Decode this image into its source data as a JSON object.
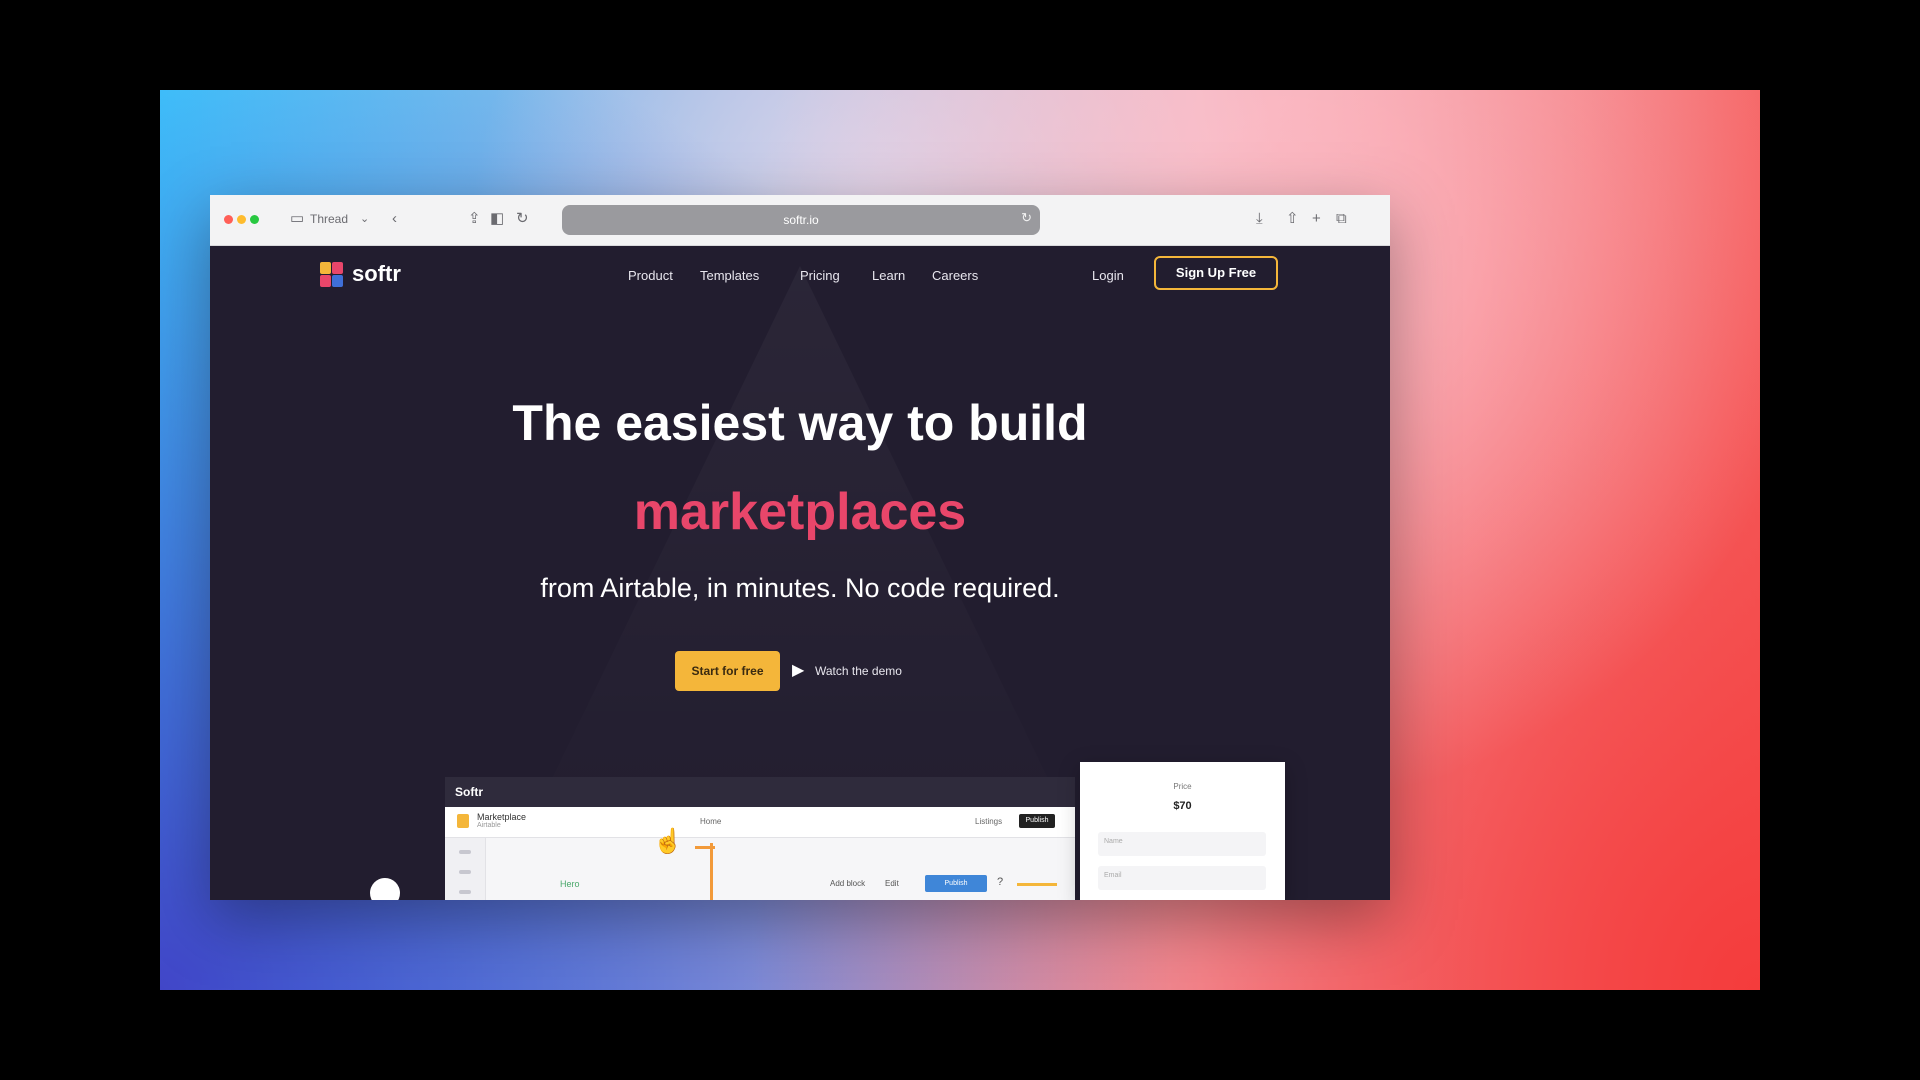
{
  "browser": {
    "tab_label": "Thread",
    "url": "softr.io",
    "icons": [
      "back-icon",
      "forward-icon",
      "sidebar-icon",
      "shield-icon",
      "reload-icon",
      "download-icon",
      "share-icon",
      "new-tab-icon",
      "tabs-icon"
    ]
  },
  "site": {
    "logo_text": "softr",
    "nav": {
      "items": [
        "Product",
        "Templates",
        "Pricing",
        "Learn",
        "Careers"
      ],
      "login": "Login",
      "signup": "Sign Up Free"
    },
    "hero": {
      "line1": "The easiest way to build",
      "highlight": "marketplaces",
      "subtitle": "from Airtable, in minutes. No code required.",
      "cta_primary": "Start for free",
      "cta_demo": "Watch the demo"
    },
    "preview": {
      "top_label": "Softr",
      "app_name": "Marketplace",
      "app_sub": "Airtable",
      "nav_items": [
        "Home",
        "Listings"
      ],
      "dark_button": "Publish",
      "green_text": "Hero",
      "row_texts": [
        "Add block",
        "Edit"
      ],
      "blue_button": "Publish",
      "panel_label": "Price",
      "panel_price": "$70",
      "panel_fields": [
        "Name",
        "Email"
      ]
    },
    "colors": {
      "accent_pink": "#e8466a",
      "accent_yellow": "#f4b63a",
      "page_bg": "#221d2f"
    }
  }
}
